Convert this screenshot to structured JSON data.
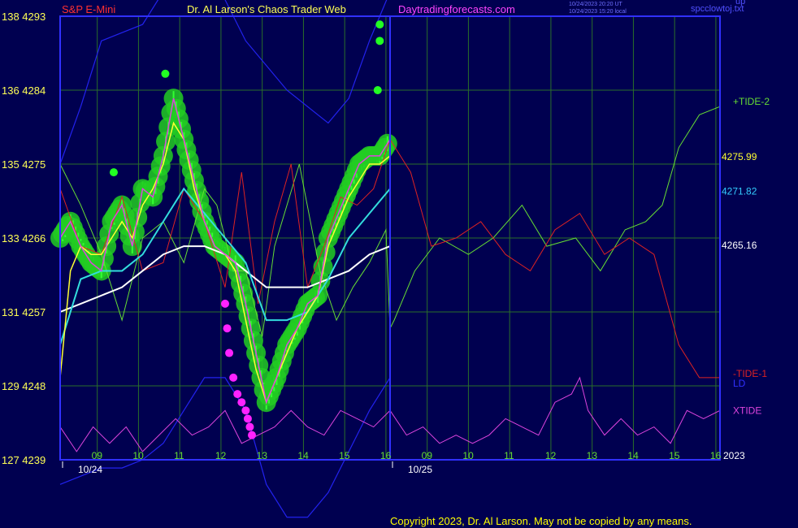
{
  "header": {
    "instrument": "S&P E-Mini",
    "title": "Dr. Al Larson's Chaos Trader Web",
    "site": "Daytradingforecasts.com",
    "timestamp_ut": "10/24/2023 20:20 UT",
    "timestamp_local": "10/24/2023 15:20 local",
    "corner_label": "spcclowtoj.txt",
    "corner_code": "up"
  },
  "footer": {
    "copyright": "Copyright 2023, Dr. Al Larson. May not be copied by any means."
  },
  "colors": {
    "background": "#000050",
    "grid": "#2a6e2a",
    "frame": "#3030ff",
    "tide_plus": "#66dd33",
    "tide_minus": "#dd2222",
    "xtide": "#dd44dd",
    "price": "#dd44dd",
    "fast_ma": "#ffff33",
    "mid_ma": "#33dddd",
    "slow_ma": "#ffffff",
    "channel": "#2222ee",
    "highlight": "#22cc22",
    "marker_green": "#22ff22",
    "marker_magenta": "#ff22ff"
  },
  "chart_data": {
    "type": "line",
    "y_axis": {
      "left_ticks": [
        {
          "label": "138",
          "price": 4293
        },
        {
          "label": "136",
          "price": 4284
        },
        {
          "label": "135",
          "price": 4275
        },
        {
          "label": "133",
          "price": 4266
        },
        {
          "label": "131",
          "price": 4257
        },
        {
          "label": "129",
          "price": 4248
        },
        {
          "label": "127",
          "price": 4239
        }
      ],
      "ylim": [
        4239,
        4293
      ]
    },
    "x_axis": {
      "hours": [
        "09",
        "10",
        "11",
        "12",
        "13",
        "14",
        "15",
        "16",
        "09",
        "10",
        "11",
        "12",
        "13",
        "14",
        "15",
        "16"
      ],
      "dates": [
        "10/24",
        "10/25"
      ],
      "year": "2023",
      "xlim": [
        0,
        16
      ],
      "day_break": 8
    },
    "right_values": [
      {
        "label": "4275.99",
        "color": "#ffff33",
        "price": 4276.0
      },
      {
        "label": "4271.82",
        "color": "#33ccff",
        "price": 4271.8
      },
      {
        "label": "4265.16",
        "color": "#ffffff",
        "price": 4265.2
      }
    ],
    "series_labels": [
      {
        "name": "+TIDE-2",
        "color": "#66dd33"
      },
      {
        "name": "-TIDE-1",
        "color": "#dd2222"
      },
      {
        "name": "LD",
        "color": "#3030ff"
      },
      {
        "name": "XTIDE",
        "color": "#dd44dd"
      }
    ],
    "price": {
      "x": [
        0.0,
        0.25,
        0.5,
        0.75,
        1.0,
        1.25,
        1.5,
        1.75,
        2.0,
        2.25,
        2.5,
        2.75,
        3.0,
        3.25,
        3.5,
        3.75,
        4.0,
        4.25,
        4.5,
        4.75,
        5.0,
        5.25,
        5.5,
        5.75,
        6.0,
        6.25,
        6.5,
        6.75,
        7.0,
        7.25,
        7.5,
        7.75,
        8.0
      ],
      "values": [
        4266,
        4268,
        4265,
        4263,
        4262,
        4268,
        4270,
        4265,
        4272,
        4271,
        4276,
        4283,
        4278,
        4273,
        4268,
        4265,
        4264,
        4263,
        4258,
        4252,
        4246,
        4249,
        4253,
        4255,
        4258,
        4259,
        4266,
        4269,
        4272,
        4275,
        4276,
        4276,
        4278
      ]
    },
    "fast_ma": {
      "x": [
        0.0,
        0.25,
        0.5,
        0.75,
        1.0,
        1.25,
        1.5,
        1.75,
        2.0,
        2.25,
        2.5,
        2.75,
        3.0,
        3.25,
        3.5,
        3.75,
        4.0,
        4.25,
        4.5,
        4.75,
        5.0,
        5.25,
        5.5,
        5.75,
        6.0,
        6.25,
        6.5,
        6.75,
        7.0,
        7.25,
        7.5,
        7.75,
        8.0
      ],
      "values": [
        4249,
        4262,
        4265,
        4264,
        4264,
        4266,
        4268,
        4266,
        4270,
        4272,
        4275,
        4280,
        4278,
        4272,
        4268,
        4265,
        4264,
        4262,
        4256,
        4250,
        4246,
        4249,
        4252,
        4255,
        4257,
        4259,
        4265,
        4268,
        4271,
        4273,
        4275,
        4275,
        4276
      ]
    },
    "mid_ma": {
      "x": [
        0.0,
        0.5,
        1.0,
        1.5,
        2.0,
        2.5,
        3.0,
        3.5,
        4.0,
        4.5,
        5.0,
        5.5,
        6.0,
        6.5,
        7.0,
        7.5,
        8.0
      ],
      "values": [
        4253,
        4261,
        4262,
        4262,
        4264,
        4268,
        4272,
        4269,
        4266,
        4263,
        4256,
        4256,
        4257,
        4261,
        4266,
        4269,
        4272
      ]
    },
    "slow_ma": {
      "x": [
        0.0,
        0.5,
        1.0,
        1.5,
        2.0,
        2.5,
        3.0,
        3.5,
        4.0,
        4.5,
        5.0,
        5.5,
        6.0,
        6.5,
        7.0,
        7.5,
        8.0
      ],
      "values": [
        4257,
        4258,
        4259,
        4260,
        4262,
        4264,
        4265,
        4265,
        4264,
        4262,
        4260,
        4260,
        4260,
        4261,
        4262,
        4264,
        4265
      ]
    },
    "tide_plus": {
      "x": [
        0.0,
        0.5,
        1.0,
        1.5,
        2.0,
        2.5,
        3.0,
        3.5,
        3.8,
        4.2,
        4.5,
        4.9,
        5.2,
        5.8,
        6.3,
        6.7,
        7.1,
        7.5,
        7.9,
        8.0,
        8.1,
        8.6,
        9.2,
        9.9,
        10.5,
        11.2,
        11.8,
        12.5,
        13.1,
        13.7,
        14.2,
        14.6,
        15.0,
        15.5,
        16.0
      ],
      "values": [
        4275,
        4270,
        4264,
        4256,
        4266,
        4268,
        4263,
        4272,
        4270,
        4262,
        4262,
        4254,
        4265,
        4275,
        4262,
        4256,
        4260,
        4263,
        4267,
        4255,
        4256,
        4262,
        4266,
        4264,
        4266,
        4270,
        4265,
        4266,
        4262,
        4267,
        4268,
        4270,
        4277,
        4281,
        4282
      ]
    },
    "tide_minus": {
      "x": [
        0.0,
        0.5,
        1.0,
        1.5,
        2.0,
        2.5,
        3.0,
        3.5,
        4.0,
        4.4,
        4.8,
        5.2,
        5.6,
        6.0,
        6.4,
        6.8,
        7.2,
        7.6,
        8.0,
        8.5,
        9.0,
        9.6,
        10.2,
        10.8,
        11.4,
        12.0,
        12.6,
        13.2,
        13.8,
        14.4,
        15.0,
        15.5,
        16.0
      ],
      "values": [
        4272,
        4265,
        4264,
        4271,
        4262,
        4263,
        4272,
        4268,
        4260,
        4274,
        4258,
        4268,
        4275,
        4260,
        4265,
        4271,
        4270,
        4272,
        4278,
        4274,
        4265,
        4266,
        4268,
        4264,
        4262,
        4267,
        4269,
        4264,
        4266,
        4264,
        4253,
        4249,
        4249
      ]
    },
    "xtide": {
      "x": [
        0.0,
        0.4,
        0.8,
        1.2,
        1.6,
        2.0,
        2.4,
        2.8,
        3.2,
        3.6,
        4.0,
        4.4,
        4.8,
        5.2,
        5.6,
        6.0,
        6.4,
        6.8,
        7.2,
        7.6,
        8.0,
        8.4,
        8.8,
        9.2,
        9.6,
        10.0,
        10.4,
        10.8,
        11.2,
        11.6,
        12.0,
        12.4,
        12.6,
        12.8,
        13.2,
        13.6,
        14.0,
        14.4,
        14.8,
        15.2,
        15.6,
        16.0
      ],
      "values": [
        4243,
        4240,
        4243,
        4241,
        4243,
        4240,
        4242,
        4244,
        4242,
        4243,
        4245,
        4241,
        4242,
        4243,
        4245,
        4243,
        4242,
        4245,
        4244,
        4243,
        4245,
        4242,
        4243,
        4241,
        4242,
        4241,
        4242,
        4244,
        4243,
        4242,
        4246,
        4247,
        4249,
        4245,
        4242,
        4244,
        4242,
        4243,
        4241,
        4245,
        4244,
        4245
      ]
    },
    "channel_upper": {
      "x": [
        0.0,
        0.5,
        1.0,
        1.5,
        2.0,
        2.5,
        3.0,
        3.5,
        4.0,
        4.5,
        5.0,
        5.5,
        6.0,
        6.5,
        7.0,
        7.5,
        8.0
      ],
      "values": [
        4275,
        4282,
        4290,
        4291,
        4292,
        4296,
        4301,
        4300,
        4295,
        4290,
        4287,
        4284,
        4282,
        4280,
        4283,
        4290,
        4296
      ]
    },
    "channel_lower": {
      "x": [
        0.0,
        0.5,
        1.0,
        1.5,
        2.0,
        2.5,
        3.0,
        3.5,
        4.0,
        4.5,
        5.0,
        5.5,
        6.0,
        6.5,
        7.0,
        7.5,
        8.0
      ],
      "values": [
        4236,
        4237,
        4238,
        4238,
        4239,
        4241,
        4245,
        4249,
        4249,
        4245,
        4236,
        4232,
        4232,
        4235,
        4240,
        4245,
        4249
      ]
    },
    "markers_green": {
      "x": [
        1.3,
        2.55,
        7.7,
        7.75,
        7.75
      ],
      "values": [
        4274,
        4286,
        4284,
        4290,
        4292
      ]
    },
    "markers_magenta": {
      "x": [
        4.0,
        4.05,
        4.1,
        4.2,
        4.3,
        4.4,
        4.5,
        4.55,
        4.6,
        4.65
      ],
      "values": [
        4258,
        4255,
        4252,
        4249,
        4247,
        4246,
        4245,
        4244,
        4243,
        4242
      ]
    }
  }
}
